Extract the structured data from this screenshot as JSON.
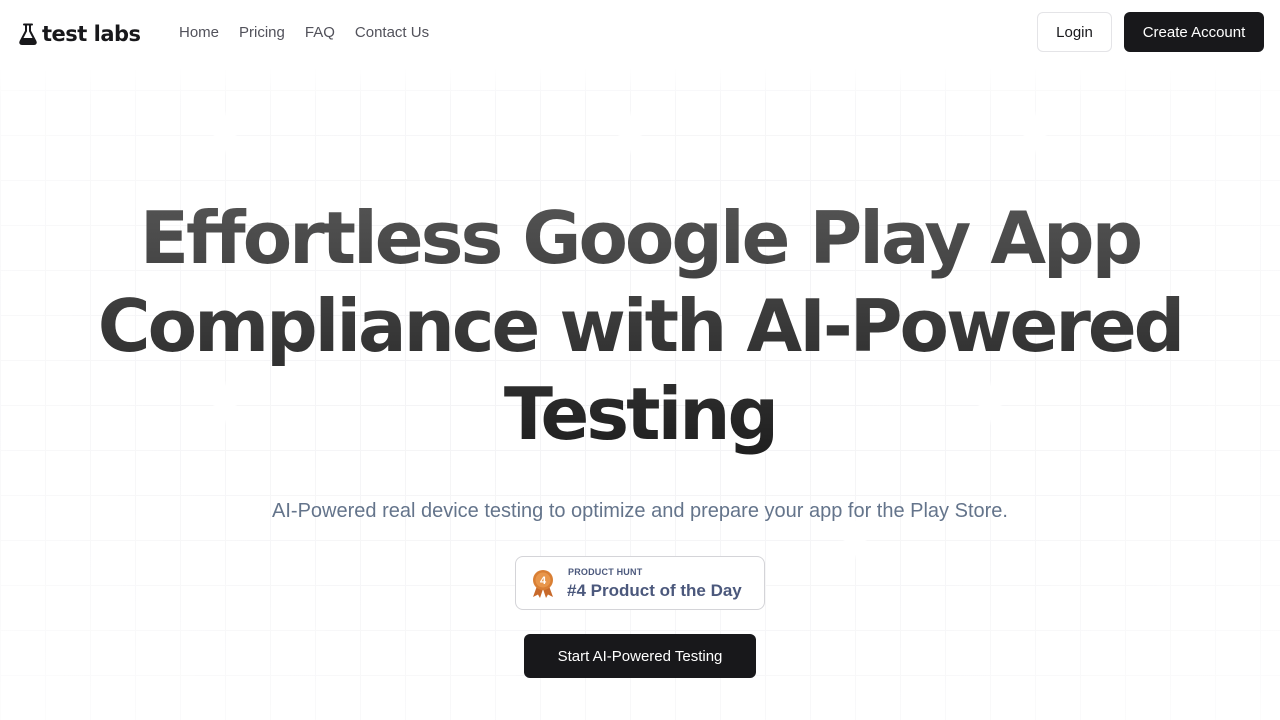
{
  "brand": {
    "name": "test labs",
    "icon": "flask-icon"
  },
  "nav": {
    "links": [
      {
        "label": "Home"
      },
      {
        "label": "Pricing"
      },
      {
        "label": "FAQ"
      },
      {
        "label": "Contact Us"
      }
    ],
    "login_label": "Login",
    "create_account_label": "Create Account"
  },
  "hero": {
    "title_lines": [
      "Effortless Google Play App",
      "Compliance with AI-Powered",
      "Testing"
    ],
    "subtitle": "AI-Powered real device testing to optimize and prepare your app for the Play Store.",
    "badge": {
      "source": "PRODUCT HUNT",
      "text": "#4 Product of the Day",
      "medal_number": "4",
      "icon": "medal-icon"
    },
    "cta_label": "Start AI-Powered Testing"
  },
  "colors": {
    "primary": "#18181b",
    "subtitle": "#64748b",
    "badge_text": "#4b587c",
    "medal": "#d97f34"
  }
}
